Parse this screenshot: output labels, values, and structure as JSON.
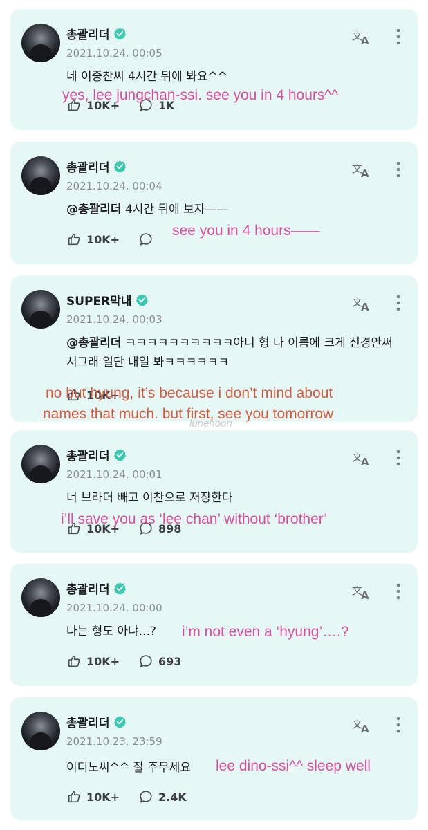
{
  "colors": {
    "card_bg": "#e6f8f5",
    "verified": "#3bc7b0",
    "caption_pink": "#d94f9e",
    "caption_red": "#d95a3f"
  },
  "posts": [
    {
      "name": "총괄리더",
      "date": "2021.10.24. 00:05",
      "text": "네 이중찬씨 4시간 뒤에 봐요^^",
      "mention": "",
      "likes": "10K+",
      "comments": "1K",
      "caption": "yes, lee jungchan-ssi. see you in 4 hours^^"
    },
    {
      "name": "총괄리더",
      "date": "2021.10.24. 00:04",
      "mention": "@총괄리더",
      "text": " 4시간 뒤에 보자——",
      "likes": "10K+",
      "comments": "",
      "caption": "see you in 4 hours——"
    },
    {
      "name": "SUPER막내",
      "date": "2021.10.24. 00:03",
      "mention": "@총괄리더",
      "text": " ㅋㅋㅋㅋㅋㅋㅋㅋㅋㅋ아니 형 나 이름에 크게 신경안써서그래 일단 내일 봐ㅋㅋㅋㅋㅋㅋ",
      "likes": "10K+",
      "comments": "",
      "caption": "no but hyung, it’s because i don’t mind about names that much. but first, see you tomorrow"
    },
    {
      "name": "총괄리더",
      "date": "2021.10.24. 00:01",
      "mention": "",
      "text": "너 브라더 빼고 이찬으로 저장한다",
      "likes": "10K+",
      "comments": "898",
      "caption": "i’ll save you as ‘lee chan’ without ‘brother’"
    },
    {
      "name": "총괄리더",
      "date": "2021.10.24. 00:00",
      "mention": "",
      "text": "나는 형도 아냐...?",
      "likes": "10K+",
      "comments": "693",
      "caption": "i’m not even a ‘hyung’….?"
    },
    {
      "name": "총괄리더",
      "date": "2021.10.23. 23:59",
      "mention": "",
      "text": "이디노씨^^ 잘 주무세요",
      "likes": "10K+",
      "comments": "2.4K",
      "caption": "lee dino-ssi^^ sleep well"
    }
  ],
  "captions_extra": {
    "post3_line1": "no but hyung, it’s because i don’t mind about",
    "post3_line2": "names that much. but first, see you tomorrow"
  },
  "watermark": "lunehoon"
}
